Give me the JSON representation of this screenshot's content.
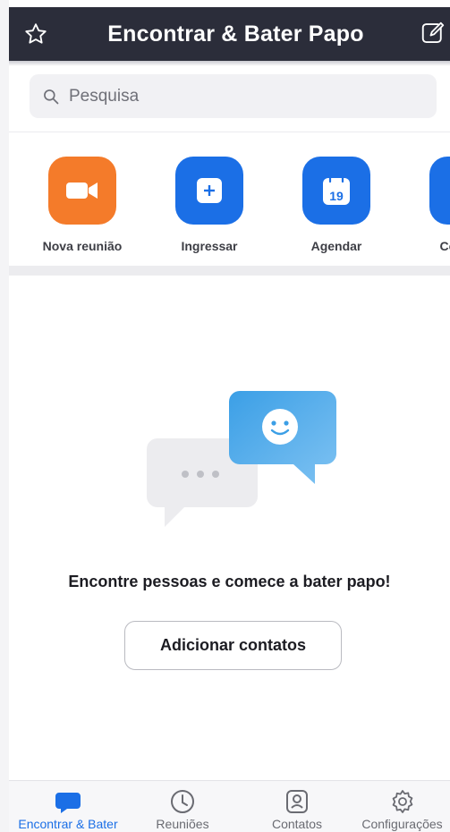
{
  "header": {
    "title": "Encontrar & Bater Papo",
    "bg_color": "#2b2d3a",
    "left_icon": "star-icon",
    "right_icon": "compose-icon"
  },
  "search": {
    "placeholder": "Pesquisa",
    "icon": "search-icon"
  },
  "actions": [
    {
      "label": "Nova reunião",
      "icon": "video-camera-icon",
      "color": "#f47b2a"
    },
    {
      "label": "Ingressar",
      "icon": "plus-icon",
      "color": "#1b6fe6"
    },
    {
      "label": "Agendar",
      "icon": "calendar-icon",
      "color": "#1b6fe6",
      "calendar_day": "19"
    },
    {
      "label": "Compar",
      "icon": "share-screen-icon",
      "color": "#1b6fe6"
    }
  ],
  "empty_state": {
    "message": "Encontre pessoas e comece a bater papo!",
    "button_label": "Adicionar contatos",
    "illustration": "chat-bubbles-illustration"
  },
  "bottom_nav": {
    "active_color": "#1b6fe6",
    "items": [
      {
        "label": "Encontrar & Bater",
        "icon": "chat-bubble-icon",
        "active": true
      },
      {
        "label": "Reuniões",
        "icon": "clock-icon",
        "active": false
      },
      {
        "label": "Contatos",
        "icon": "contact-card-icon",
        "active": false
      },
      {
        "label": "Configurações",
        "icon": "gear-icon",
        "active": false
      }
    ]
  }
}
